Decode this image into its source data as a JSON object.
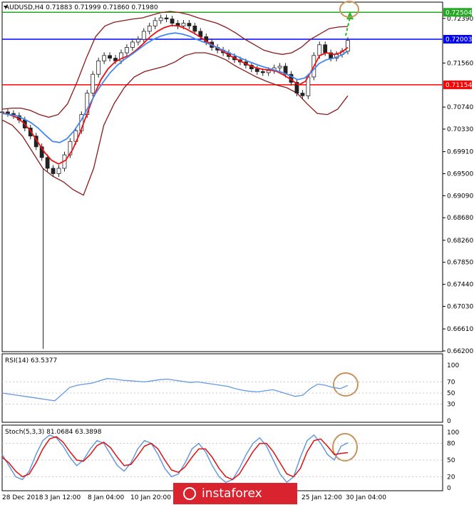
{
  "chart_data": [
    {
      "type": "candlestick",
      "symbol_header": "AUDUSD,H4  0.71883 0.71999 0.71860 0.71980",
      "ylim": [
        0.662,
        0.7268
      ],
      "y_ticks": [
        "0.72390",
        "0.71560",
        "0.70740",
        "0.70330",
        "0.69910",
        "0.69500",
        "0.69090",
        "0.68680",
        "0.68260",
        "0.67850",
        "0.67440",
        "0.67030",
        "0.66610",
        "0.66200"
      ],
      "price_lines": [
        {
          "label": "0.72504",
          "value": 0.72504,
          "color": "#22aa22"
        },
        {
          "label": "0.72003",
          "value": 0.72003,
          "color": "#0000ff"
        },
        {
          "label": "0.71154",
          "value": 0.71154,
          "color": "#ff0000"
        }
      ],
      "close_series_sampled": [
        0.7065,
        0.7062,
        0.7058,
        0.705,
        0.7035,
        0.702,
        0.7,
        0.698,
        0.696,
        0.695,
        0.696,
        0.6985,
        0.701,
        0.703,
        0.706,
        0.71,
        0.7135,
        0.716,
        0.717,
        0.7165,
        0.716,
        0.7175,
        0.7185,
        0.7195,
        0.72,
        0.7215,
        0.7225,
        0.7235,
        0.724,
        0.7238,
        0.723,
        0.7225,
        0.723,
        0.7225,
        0.7215,
        0.7205,
        0.7195,
        0.7185,
        0.718,
        0.7175,
        0.7168,
        0.7162,
        0.7158,
        0.7152,
        0.7145,
        0.714,
        0.7138,
        0.7142,
        0.7147,
        0.715,
        0.7135,
        0.712,
        0.71,
        0.7095,
        0.713,
        0.717,
        0.719,
        0.7175,
        0.7165,
        0.7172,
        0.7178,
        0.7198
      ],
      "moving_averages": [
        {
          "color": "#ee1111",
          "values": [
            0.7063,
            0.706,
            0.7055,
            0.7045,
            0.703,
            0.701,
            0.699,
            0.6975,
            0.6968,
            0.6975,
            0.6995,
            0.7025,
            0.706,
            0.7095,
            0.7125,
            0.7145,
            0.7158,
            0.7165,
            0.717,
            0.718,
            0.7192,
            0.7205,
            0.7215,
            0.7222,
            0.7226,
            0.7225,
            0.722,
            0.7213,
            0.7205,
            0.7196,
            0.7188,
            0.718,
            0.7172,
            0.7165,
            0.7158,
            0.7152,
            0.7147,
            0.7144,
            0.7143,
            0.714,
            0.7133,
            0.7125,
            0.7115,
            0.7122,
            0.7145,
            0.717,
            0.7175,
            0.7172,
            0.7175,
            0.7185
          ]
        },
        {
          "color": "#4488ee",
          "values": [
            0.7062,
            0.706,
            0.7058,
            0.7052,
            0.7045,
            0.7035,
            0.7022,
            0.701,
            0.7008,
            0.7015,
            0.703,
            0.705,
            0.7075,
            0.71,
            0.712,
            0.7138,
            0.7152,
            0.7163,
            0.7172,
            0.7182,
            0.7192,
            0.72,
            0.7206,
            0.721,
            0.7212,
            0.721,
            0.7206,
            0.72,
            0.7195,
            0.719,
            0.7184,
            0.7178,
            0.7172,
            0.7166,
            0.716,
            0.7155,
            0.715,
            0.7146,
            0.7142,
            0.7138,
            0.7132,
            0.7125,
            0.7128,
            0.714,
            0.7155,
            0.7162,
            0.7165,
            0.717,
            0.7178
          ]
        }
      ],
      "bollinger": {
        "color": "#8b1a1a",
        "upper": [
          0.707,
          0.7072,
          0.7072,
          0.7068,
          0.706,
          0.7055,
          0.706,
          0.708,
          0.712,
          0.7165,
          0.7205,
          0.7225,
          0.7232,
          0.7235,
          0.7238,
          0.724,
          0.7245,
          0.725,
          0.7252,
          0.725,
          0.7246,
          0.724,
          0.7235,
          0.723,
          0.7222,
          0.7212,
          0.72,
          0.719,
          0.718,
          0.7175,
          0.7172,
          0.7175,
          0.7185,
          0.72,
          0.721,
          0.722,
          0.7223,
          0.7224
        ],
        "lower": [
          0.705,
          0.704,
          0.702,
          0.699,
          0.696,
          0.6945,
          0.6935,
          0.692,
          0.691,
          0.696,
          0.704,
          0.708,
          0.711,
          0.713,
          0.714,
          0.7145,
          0.715,
          0.7158,
          0.717,
          0.7175,
          0.7175,
          0.717,
          0.7162,
          0.715,
          0.714,
          0.713,
          0.7122,
          0.7115,
          0.711,
          0.71,
          0.708,
          0.7062,
          0.706,
          0.707,
          0.7095
        ]
      },
      "annotations": [
        "green dashed arrow pointing up to 0.72504",
        "circle at price target"
      ]
    },
    {
      "type": "line",
      "label": "RSI(14) 63.5377",
      "ylim": [
        0,
        100
      ],
      "y_ticks": [
        "100",
        "70",
        "50",
        "30",
        "0"
      ],
      "line_color": "#6699dd",
      "values": [
        50,
        48,
        46,
        44,
        42,
        40,
        38,
        36,
        48,
        60,
        64,
        66,
        68,
        72,
        76,
        75,
        73,
        72,
        71,
        70,
        72,
        74,
        75,
        73,
        71,
        69,
        70,
        68,
        66,
        64,
        62,
        58,
        55,
        53,
        52,
        54,
        56,
        52,
        48,
        44,
        46,
        58,
        66,
        64,
        60,
        58,
        63.5377
      ]
    },
    {
      "type": "line",
      "label": "Stoch(5,3,3) 81.0684 63.3898",
      "ylim": [
        0,
        100
      ],
      "y_ticks": [
        "100",
        "80",
        "50",
        "20",
        "0"
      ],
      "series": [
        {
          "name": "",
          "color": "#6699dd",
          "values": [
            60,
            40,
            20,
            15,
            30,
            60,
            85,
            95,
            90,
            75,
            55,
            40,
            50,
            70,
            85,
            80,
            60,
            40,
            30,
            45,
            70,
            85,
            80,
            60,
            35,
            20,
            25,
            45,
            70,
            80,
            65,
            40,
            20,
            10,
            15,
            35,
            60,
            80,
            90,
            75,
            50,
            25,
            10,
            20,
            55,
            85,
            95,
            80,
            60,
            50,
            75,
            81.0684
          ]
        },
        {
          "name": "",
          "color": "#dd1111",
          "values": [
            55,
            45,
            30,
            20,
            25,
            45,
            70,
            88,
            92,
            82,
            65,
            50,
            48,
            60,
            76,
            82,
            72,
            55,
            40,
            42,
            58,
            75,
            80,
            70,
            50,
            32,
            28,
            38,
            55,
            70,
            70,
            55,
            35,
            20,
            15,
            25,
            45,
            65,
            80,
            80,
            65,
            45,
            25,
            20,
            35,
            65,
            85,
            88,
            75,
            60,
            62,
            63.3898
          ]
        }
      ]
    }
  ],
  "x_labels": [
    "28 Dec 2018",
    "3 Jan 12:00",
    "8 Jan 04:00",
    "10 Jan 20:00",
    "25 Jan 12:00",
    "30 Jan 04:00"
  ],
  "watermark": {
    "text": "instaforex"
  }
}
